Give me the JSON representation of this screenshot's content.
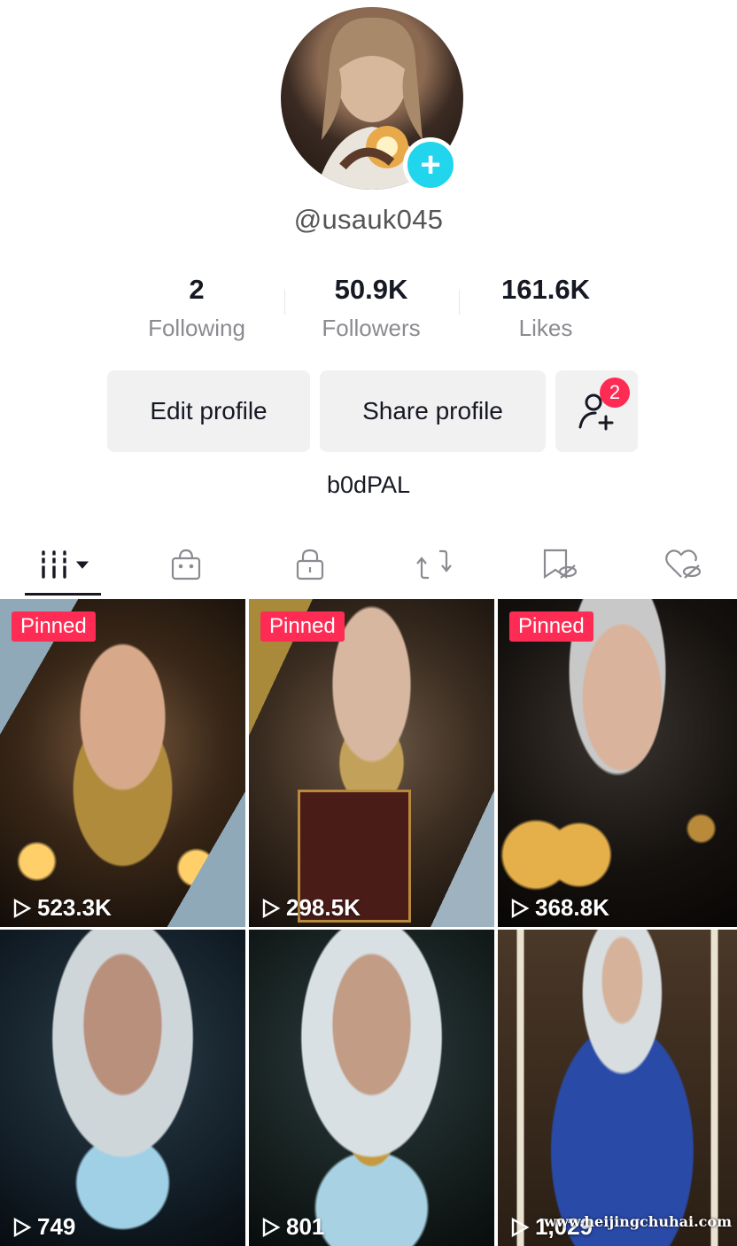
{
  "profile": {
    "username": "@usauk045",
    "bio": "b0dPAL",
    "add_icon": "plus-icon"
  },
  "stats": [
    {
      "value": "2",
      "label": "Following"
    },
    {
      "value": "50.9K",
      "label": "Followers"
    },
    {
      "value": "161.6K",
      "label": "Likes"
    }
  ],
  "buttons": {
    "edit": "Edit profile",
    "share": "Share profile",
    "friends_badge": "2",
    "friends_icon": "add-friend-icon"
  },
  "tabs": [
    {
      "icon": "grid-videos-icon",
      "active": true
    },
    {
      "icon": "shop-bag-icon",
      "active": false
    },
    {
      "icon": "private-lock-icon",
      "active": false
    },
    {
      "icon": "repost-icon",
      "active": false
    },
    {
      "icon": "favorites-hidden-icon",
      "active": false
    },
    {
      "icon": "liked-hidden-icon",
      "active": false
    }
  ],
  "videos": [
    {
      "pinned": "Pinned",
      "views": "523.3K"
    },
    {
      "pinned": "Pinned",
      "views": "298.5K"
    },
    {
      "pinned": "Pinned",
      "views": "368.8K"
    },
    {
      "pinned": "",
      "views": "749"
    },
    {
      "pinned": "",
      "views": "801"
    },
    {
      "pinned": "",
      "views": "1,029"
    }
  ],
  "watermark": "www.heijingchuhai.com",
  "colors": {
    "accent_red": "#fe2c55",
    "accent_cyan": "#20d5ec",
    "button_bg": "#f1f1f2"
  }
}
